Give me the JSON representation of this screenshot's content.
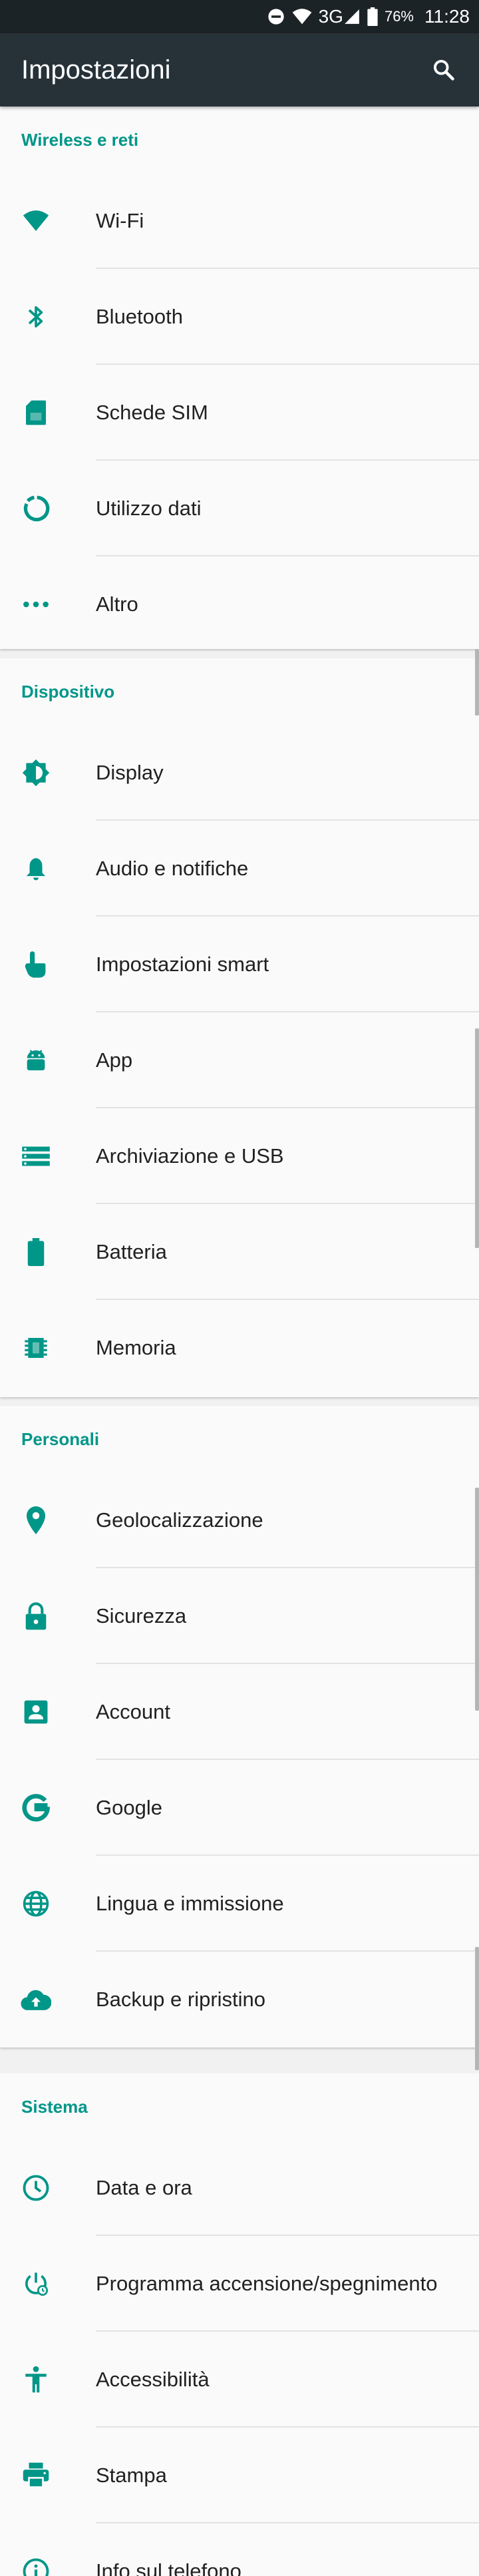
{
  "status_bar": {
    "icons": [
      "do-not-disturb-icon",
      "wifi-icon",
      "3g-signal-icon",
      "battery-icon"
    ],
    "network": "3G",
    "battery": "76%",
    "time": "11:28"
  },
  "toolbar": {
    "title": "Impostazioni",
    "search_icon": "search-icon"
  },
  "colors": {
    "accent": "#009688",
    "toolbar": "#263238",
    "status_bar": "#1c2327",
    "text": "#212121"
  },
  "sections": [
    {
      "title": "Wireless e reti",
      "items": [
        {
          "label": "Wi-Fi",
          "icon": "wifi-icon"
        },
        {
          "label": "Bluetooth",
          "icon": "bluetooth-icon"
        },
        {
          "label": "Schede SIM",
          "icon": "sim-card-icon"
        },
        {
          "label": "Utilizzo dati",
          "icon": "data-usage-icon"
        },
        {
          "label": "Altro",
          "icon": "more-dots-icon"
        }
      ]
    },
    {
      "title": "Dispositivo",
      "items": [
        {
          "label": "Display",
          "icon": "brightness-icon"
        },
        {
          "label": "Audio e notifiche",
          "icon": "bell-icon"
        },
        {
          "label": "Impostazioni smart",
          "icon": "hand-pointer-icon"
        },
        {
          "label": "App",
          "icon": "android-icon"
        },
        {
          "label": "Archiviazione e USB",
          "icon": "storage-icon"
        },
        {
          "label": "Batteria",
          "icon": "battery-icon"
        },
        {
          "label": "Memoria",
          "icon": "memory-chip-icon"
        }
      ]
    },
    {
      "title": "Personali",
      "items": [
        {
          "label": "Geolocalizzazione",
          "icon": "location-pin-icon"
        },
        {
          "label": "Sicurezza",
          "icon": "lock-icon"
        },
        {
          "label": "Account",
          "icon": "account-box-icon"
        },
        {
          "label": "Google",
          "icon": "google-icon"
        },
        {
          "label": "Lingua e immissione",
          "icon": "globe-icon"
        },
        {
          "label": "Backup e ripristino",
          "icon": "cloud-upload-icon"
        }
      ]
    },
    {
      "title": "Sistema",
      "items": [
        {
          "label": "Data e ora",
          "icon": "clock-icon"
        },
        {
          "label": "Programma accensione/spegnimento",
          "icon": "power-schedule-icon"
        },
        {
          "label": "Accessibilità",
          "icon": "accessibility-icon"
        },
        {
          "label": "Stampa",
          "icon": "printer-icon"
        },
        {
          "label": "Info sul telefono",
          "icon": "info-icon"
        }
      ]
    }
  ]
}
